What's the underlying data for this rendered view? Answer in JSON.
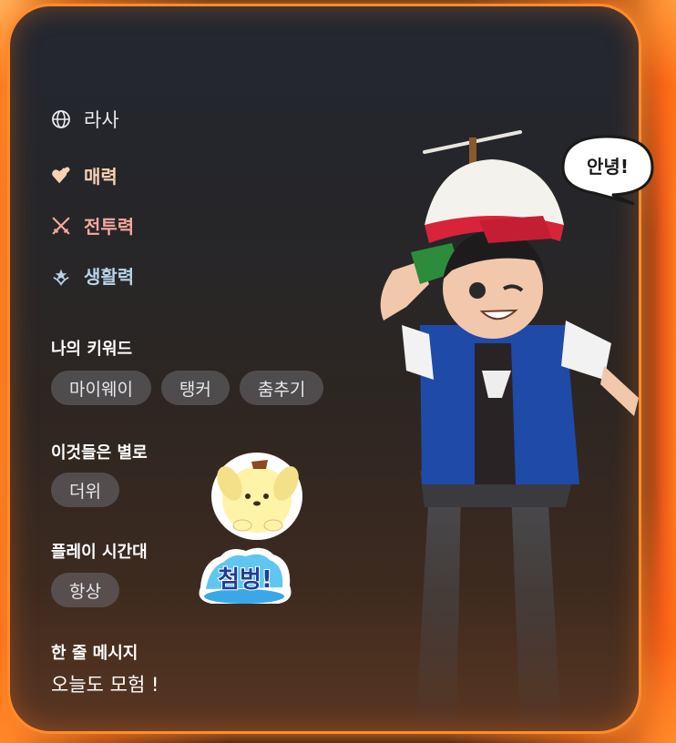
{
  "profile": {
    "region": "라사",
    "stats": [
      {
        "label": "매력",
        "icon": "hearts-icon",
        "color": "#f7d2b3"
      },
      {
        "label": "전투력",
        "icon": "crossed-swords-icon",
        "color": "#f4a8a0"
      },
      {
        "label": "생활력",
        "icon": "sprout-icon",
        "color": "#b6d3e6"
      }
    ],
    "keywords": {
      "title": "나의 키워드",
      "items": [
        "마이웨이",
        "탱커",
        "춤추기"
      ]
    },
    "dislikes": {
      "title": "이것들은 별로",
      "items": [
        "더위"
      ]
    },
    "playtime": {
      "title": "플레이 시간대",
      "items": [
        "항상"
      ]
    },
    "message": {
      "title": "한 줄 메시지",
      "text": "오늘도 모험 !"
    }
  },
  "speech_bubble": "안녕!",
  "sticker_text": "첨벙!",
  "colors": {
    "glow": "#ff8c2f",
    "chip_bg": "#6e6c73"
  }
}
